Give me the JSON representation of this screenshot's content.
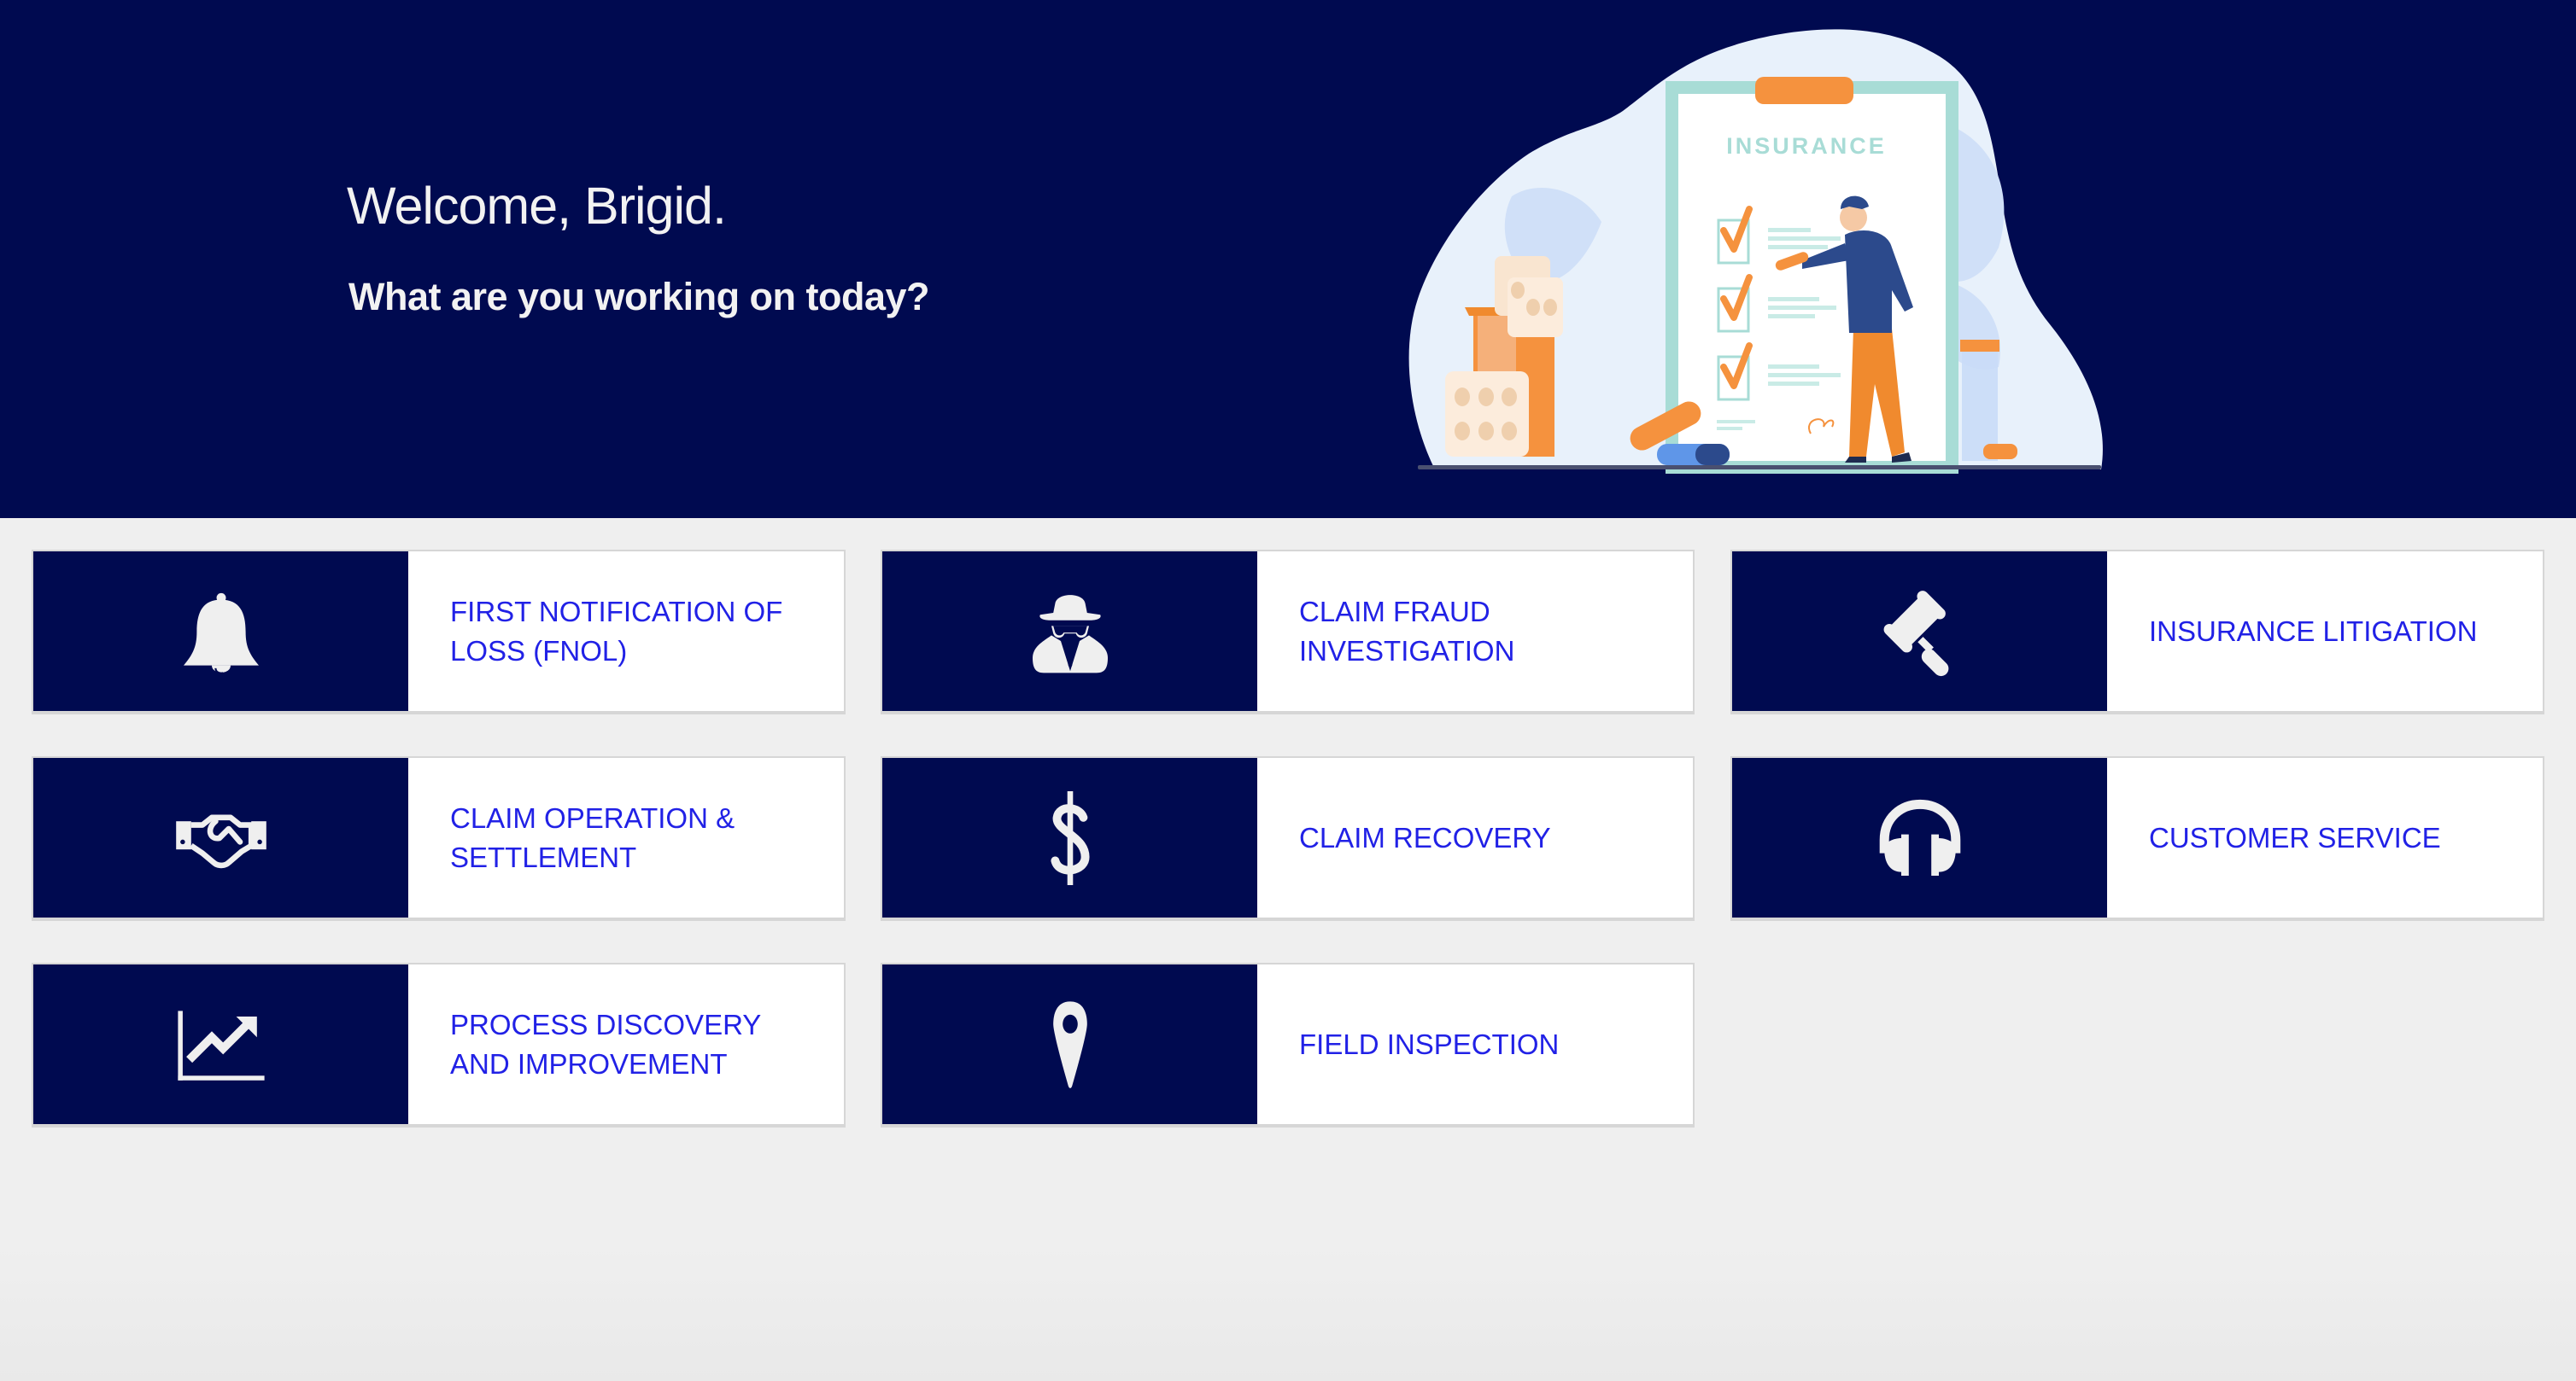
{
  "header": {
    "greeting": "Welcome, Brigid.",
    "prompt": "What are you working on today?",
    "illustration_text": "INSURANCE"
  },
  "colors": {
    "navy": "#000a50",
    "link_blue": "#2121e6",
    "icon_fill": "#efefef",
    "page_bg": "#efefef"
  },
  "cards": [
    {
      "label": "FIRST NOTIFICATION OF LOSS (FNOL)",
      "icon": "bell-icon"
    },
    {
      "label": "CLAIM FRAUD INVESTIGATION",
      "icon": "spy-icon"
    },
    {
      "label": "INSURANCE LITIGATION",
      "icon": "gavel-icon"
    },
    {
      "label": "CLAIM OPERATION & SETTLEMENT",
      "icon": "handshake-icon"
    },
    {
      "label": "CLAIM RECOVERY",
      "icon": "dollar-icon"
    },
    {
      "label": "CUSTOMER SERVICE",
      "icon": "headphones-icon"
    },
    {
      "label": "PROCESS DISCOVERY AND IMPROVEMENT",
      "icon": "chart-line-icon"
    },
    {
      "label": "FIELD INSPECTION",
      "icon": "map-marker-icon"
    }
  ]
}
